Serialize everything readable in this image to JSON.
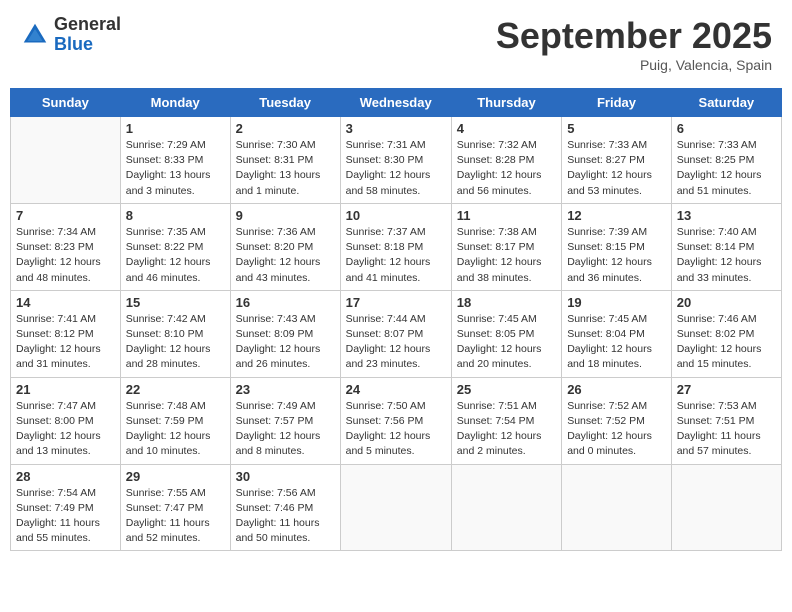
{
  "header": {
    "logo": {
      "general": "General",
      "blue": "Blue"
    },
    "month": "September 2025",
    "location": "Puig, Valencia, Spain"
  },
  "weekdays": [
    "Sunday",
    "Monday",
    "Tuesday",
    "Wednesday",
    "Thursday",
    "Friday",
    "Saturday"
  ],
  "weeks": [
    [
      {
        "day": "",
        "info": ""
      },
      {
        "day": "1",
        "info": "Sunrise: 7:29 AM\nSunset: 8:33 PM\nDaylight: 13 hours\nand 3 minutes."
      },
      {
        "day": "2",
        "info": "Sunrise: 7:30 AM\nSunset: 8:31 PM\nDaylight: 13 hours\nand 1 minute."
      },
      {
        "day": "3",
        "info": "Sunrise: 7:31 AM\nSunset: 8:30 PM\nDaylight: 12 hours\nand 58 minutes."
      },
      {
        "day": "4",
        "info": "Sunrise: 7:32 AM\nSunset: 8:28 PM\nDaylight: 12 hours\nand 56 minutes."
      },
      {
        "day": "5",
        "info": "Sunrise: 7:33 AM\nSunset: 8:27 PM\nDaylight: 12 hours\nand 53 minutes."
      },
      {
        "day": "6",
        "info": "Sunrise: 7:33 AM\nSunset: 8:25 PM\nDaylight: 12 hours\nand 51 minutes."
      }
    ],
    [
      {
        "day": "7",
        "info": "Sunrise: 7:34 AM\nSunset: 8:23 PM\nDaylight: 12 hours\nand 48 minutes."
      },
      {
        "day": "8",
        "info": "Sunrise: 7:35 AM\nSunset: 8:22 PM\nDaylight: 12 hours\nand 46 minutes."
      },
      {
        "day": "9",
        "info": "Sunrise: 7:36 AM\nSunset: 8:20 PM\nDaylight: 12 hours\nand 43 minutes."
      },
      {
        "day": "10",
        "info": "Sunrise: 7:37 AM\nSunset: 8:18 PM\nDaylight: 12 hours\nand 41 minutes."
      },
      {
        "day": "11",
        "info": "Sunrise: 7:38 AM\nSunset: 8:17 PM\nDaylight: 12 hours\nand 38 minutes."
      },
      {
        "day": "12",
        "info": "Sunrise: 7:39 AM\nSunset: 8:15 PM\nDaylight: 12 hours\nand 36 minutes."
      },
      {
        "day": "13",
        "info": "Sunrise: 7:40 AM\nSunset: 8:14 PM\nDaylight: 12 hours\nand 33 minutes."
      }
    ],
    [
      {
        "day": "14",
        "info": "Sunrise: 7:41 AM\nSunset: 8:12 PM\nDaylight: 12 hours\nand 31 minutes."
      },
      {
        "day": "15",
        "info": "Sunrise: 7:42 AM\nSunset: 8:10 PM\nDaylight: 12 hours\nand 28 minutes."
      },
      {
        "day": "16",
        "info": "Sunrise: 7:43 AM\nSunset: 8:09 PM\nDaylight: 12 hours\nand 26 minutes."
      },
      {
        "day": "17",
        "info": "Sunrise: 7:44 AM\nSunset: 8:07 PM\nDaylight: 12 hours\nand 23 minutes."
      },
      {
        "day": "18",
        "info": "Sunrise: 7:45 AM\nSunset: 8:05 PM\nDaylight: 12 hours\nand 20 minutes."
      },
      {
        "day": "19",
        "info": "Sunrise: 7:45 AM\nSunset: 8:04 PM\nDaylight: 12 hours\nand 18 minutes."
      },
      {
        "day": "20",
        "info": "Sunrise: 7:46 AM\nSunset: 8:02 PM\nDaylight: 12 hours\nand 15 minutes."
      }
    ],
    [
      {
        "day": "21",
        "info": "Sunrise: 7:47 AM\nSunset: 8:00 PM\nDaylight: 12 hours\nand 13 minutes."
      },
      {
        "day": "22",
        "info": "Sunrise: 7:48 AM\nSunset: 7:59 PM\nDaylight: 12 hours\nand 10 minutes."
      },
      {
        "day": "23",
        "info": "Sunrise: 7:49 AM\nSunset: 7:57 PM\nDaylight: 12 hours\nand 8 minutes."
      },
      {
        "day": "24",
        "info": "Sunrise: 7:50 AM\nSunset: 7:56 PM\nDaylight: 12 hours\nand 5 minutes."
      },
      {
        "day": "25",
        "info": "Sunrise: 7:51 AM\nSunset: 7:54 PM\nDaylight: 12 hours\nand 2 minutes."
      },
      {
        "day": "26",
        "info": "Sunrise: 7:52 AM\nSunset: 7:52 PM\nDaylight: 12 hours\nand 0 minutes."
      },
      {
        "day": "27",
        "info": "Sunrise: 7:53 AM\nSunset: 7:51 PM\nDaylight: 11 hours\nand 57 minutes."
      }
    ],
    [
      {
        "day": "28",
        "info": "Sunrise: 7:54 AM\nSunset: 7:49 PM\nDaylight: 11 hours\nand 55 minutes."
      },
      {
        "day": "29",
        "info": "Sunrise: 7:55 AM\nSunset: 7:47 PM\nDaylight: 11 hours\nand 52 minutes."
      },
      {
        "day": "30",
        "info": "Sunrise: 7:56 AM\nSunset: 7:46 PM\nDaylight: 11 hours\nand 50 minutes."
      },
      {
        "day": "",
        "info": ""
      },
      {
        "day": "",
        "info": ""
      },
      {
        "day": "",
        "info": ""
      },
      {
        "day": "",
        "info": ""
      }
    ]
  ]
}
